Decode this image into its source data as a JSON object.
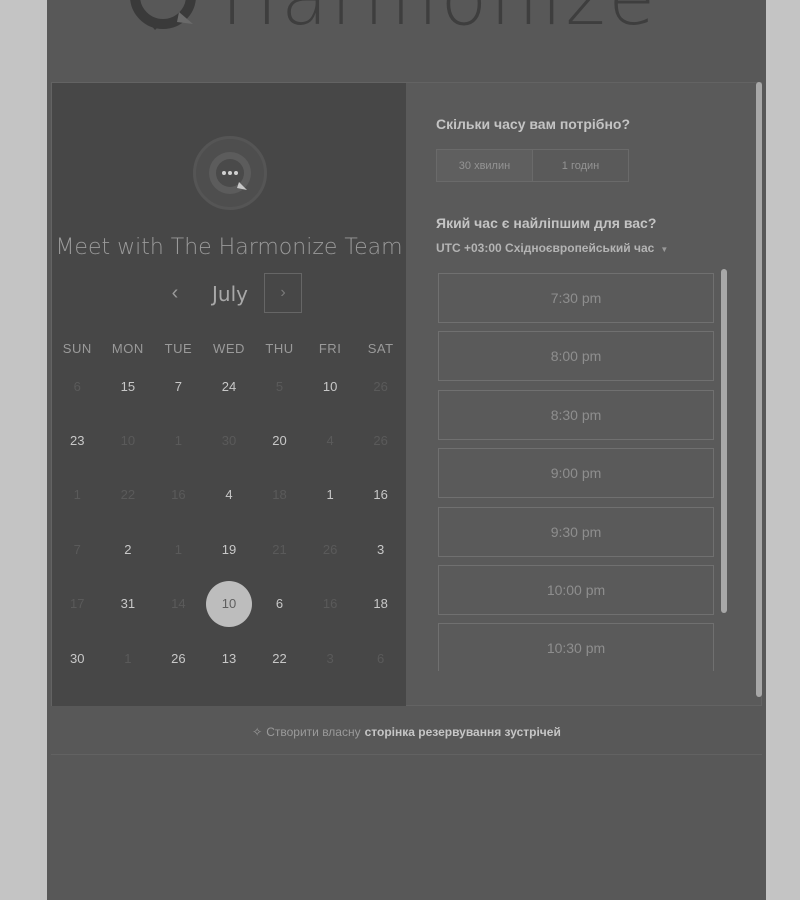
{
  "brand": {
    "name": "Harmonize"
  },
  "calendar": {
    "title": "Meet with The Harmonize Team",
    "month": "July",
    "prev_icon": "‹",
    "next_icon": "›",
    "weekdays": [
      "SUN",
      "MON",
      "TUE",
      "WED",
      "THU",
      "FRI",
      "SAT"
    ],
    "days": [
      {
        "label": "6",
        "active": false
      },
      {
        "label": "15",
        "active": true
      },
      {
        "label": "7",
        "active": true
      },
      {
        "label": "24",
        "active": true
      },
      {
        "label": "5",
        "active": false
      },
      {
        "label": "10",
        "active": true
      },
      {
        "label": "26",
        "active": false
      },
      {
        "label": "23",
        "active": true
      },
      {
        "label": "10",
        "active": false
      },
      {
        "label": "1",
        "active": false
      },
      {
        "label": "30",
        "active": false
      },
      {
        "label": "20",
        "active": true
      },
      {
        "label": "4",
        "active": false
      },
      {
        "label": "26",
        "active": false
      },
      {
        "label": "1",
        "active": false
      },
      {
        "label": "22",
        "active": false
      },
      {
        "label": "16",
        "active": false
      },
      {
        "label": "4",
        "active": true
      },
      {
        "label": "18",
        "active": false
      },
      {
        "label": "1",
        "active": true
      },
      {
        "label": "16",
        "active": true
      },
      {
        "label": "7",
        "active": false
      },
      {
        "label": "2",
        "active": true
      },
      {
        "label": "1",
        "active": false
      },
      {
        "label": "19",
        "active": true
      },
      {
        "label": "21",
        "active": false
      },
      {
        "label": "26",
        "active": false
      },
      {
        "label": "3",
        "active": true
      },
      {
        "label": "17",
        "active": false
      },
      {
        "label": "31",
        "active": true
      },
      {
        "label": "14",
        "active": false
      },
      {
        "label": "10",
        "active": true,
        "selected": true
      },
      {
        "label": "6",
        "active": true
      },
      {
        "label": "16",
        "active": false
      },
      {
        "label": "18",
        "active": true
      },
      {
        "label": "30",
        "active": true
      },
      {
        "label": "1",
        "active": false
      },
      {
        "label": "26",
        "active": true
      },
      {
        "label": "13",
        "active": true
      },
      {
        "label": "22",
        "active": true
      },
      {
        "label": "3",
        "active": false
      },
      {
        "label": "6",
        "active": false
      }
    ]
  },
  "booking": {
    "duration_heading": "Скільки часу вам потрібно?",
    "durations": [
      {
        "label": "30 хвилин",
        "active": true
      },
      {
        "label": "1 годин",
        "active": false
      }
    ],
    "time_heading": "Який час є найліпшим для вас?",
    "timezone": "UTC +03:00 Східноєвропейський час",
    "slots": [
      "7:30 pm",
      "8:00 pm",
      "8:30 pm",
      "9:00 pm",
      "9:30 pm",
      "10:00 pm",
      "10:30 pm"
    ]
  },
  "footer": {
    "text": "Створити власну",
    "link": "сторінка резервування зустрічей"
  },
  "icons": {
    "logo": "chat-bubble-logo-icon",
    "avatar": "chat-bubble-avatar-icon",
    "footer": "sparkle-icon",
    "timezone_caret": "caret-down-icon"
  }
}
